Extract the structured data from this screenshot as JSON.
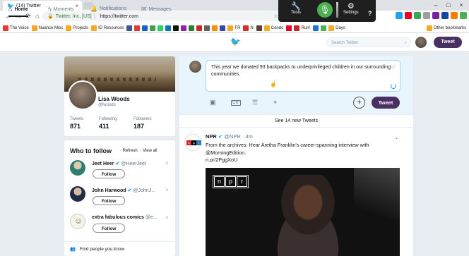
{
  "browser": {
    "tab_title": "(14) Twitter",
    "site_label": "Twitter, Inc. [US]",
    "url": "https://twitter.com",
    "bookmarks": [
      {
        "label": "The Voice",
        "color": "#e53935"
      },
      {
        "label": "Nuance Misc",
        "color": "#f9a825"
      },
      {
        "label": "Projects",
        "color": "#f9a825"
      },
      {
        "label": "ID Resources",
        "color": "#f9a825"
      },
      {
        "label": "FR",
        "color": "#f9a825"
      },
      {
        "label": "N",
        "color": "#f9a825"
      },
      {
        "label": "Condo",
        "color": "#f9a825"
      },
      {
        "label": "Run!",
        "color": "#f9a825"
      },
      {
        "label": "Days",
        "color": "#f9a825"
      },
      {
        "label": "Other bookmarks",
        "color": "#f9a825"
      }
    ]
  },
  "dragon": {
    "tools_label": "Tools",
    "settings_label": "Settings",
    "help_label": "?",
    "accent": "#4caf50"
  },
  "nav": {
    "home": "Home",
    "moments": "Moments",
    "notifications": "Notifications",
    "messages": "Messages",
    "search_placeholder": "Search Twitter",
    "tweet_button": "Tweet"
  },
  "profile": {
    "name": "Lisa Woods",
    "handle": "@lwoods",
    "stats": [
      {
        "label": "Tweets",
        "value": "871"
      },
      {
        "label": "Following",
        "value": "411"
      },
      {
        "label": "Followers",
        "value": "187"
      }
    ]
  },
  "who_to_follow": {
    "title": "Who to follow",
    "refresh": "· Refresh",
    "view_all": "· View all",
    "follow_label": "Follow",
    "find_people": "Find people you know",
    "accounts": [
      {
        "name": "Jeet Heer",
        "verified": true,
        "handle": "@HeerJeet"
      },
      {
        "name": "John Harwood",
        "verified": true,
        "handle": "@JohnJ..."
      },
      {
        "name": "extra fabulous comics",
        "verified": false,
        "handle": "@e..."
      }
    ]
  },
  "compose": {
    "text": "This year we donated 93 backpacks to underprivileged children in our surrounding communities.",
    "tweet_button": "Tweet",
    "plus": "+"
  },
  "feed": {
    "new_tweets_banner": "See 14 new Tweets",
    "tweet": {
      "author": "NPR",
      "handle": "@NPR",
      "time": "· 4m",
      "text": "From the archives: Hear Aretha Franklin's career-spanning interview with @MorningEdition.",
      "link": "n.pr/2PggXoU",
      "media_badge": [
        "n",
        "p",
        "r"
      ]
    }
  },
  "colors": {
    "twitter_blue": "#1da1f2",
    "tweet_button": "#4a2f63",
    "background": "#e6ecf0"
  }
}
